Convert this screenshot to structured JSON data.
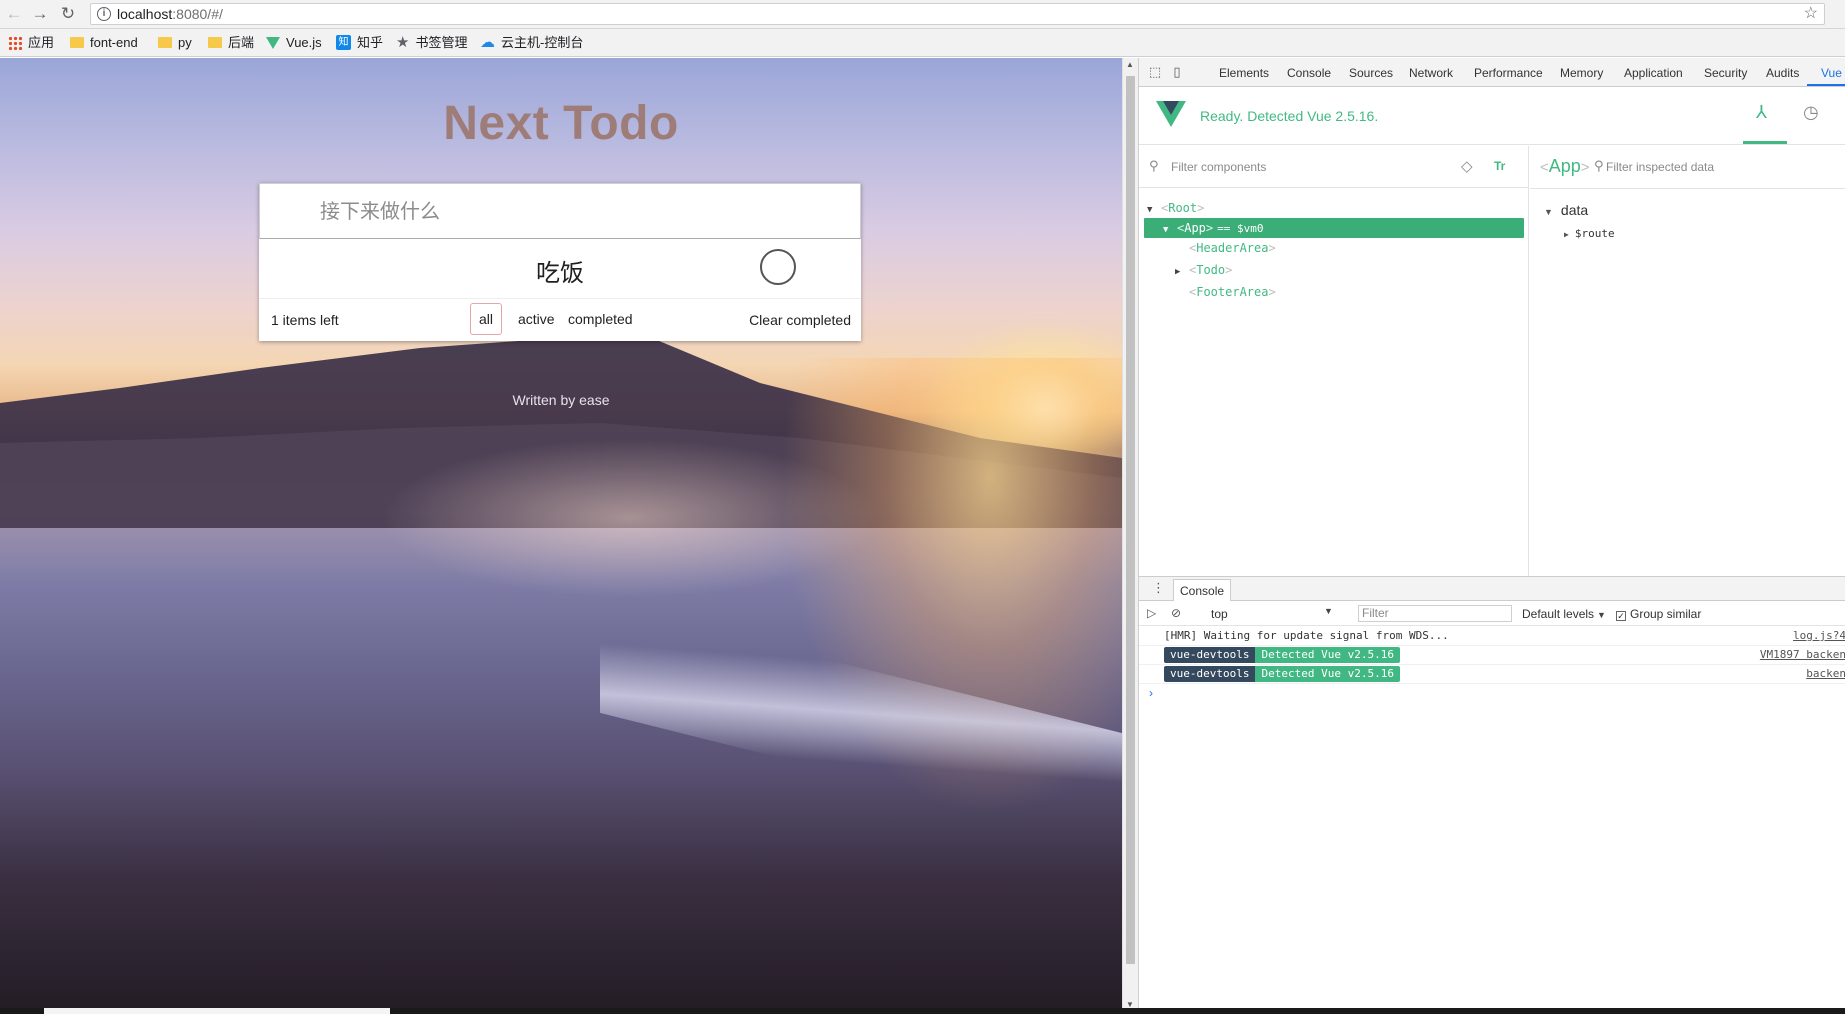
{
  "browser": {
    "url_host": "localhost",
    "url_rest": ":8080/#/",
    "bookmarks": [
      {
        "label": "应用",
        "icon": "apps-grid-icon"
      },
      {
        "label": "font-end",
        "icon": "folder-icon"
      },
      {
        "label": "py",
        "icon": "folder-icon"
      },
      {
        "label": "后端",
        "icon": "folder-icon"
      },
      {
        "label": "Vue.js",
        "icon": "vue-logo-icon"
      },
      {
        "label": "知乎",
        "icon": "zhihu-icon"
      },
      {
        "label": "书签管理",
        "icon": "star-icon"
      },
      {
        "label": "云主机-控制台",
        "icon": "cloud-icon"
      }
    ]
  },
  "app": {
    "title": "Next Todo",
    "input_placeholder": "接下来做什么",
    "todos": [
      {
        "text": "吃饭",
        "completed": false
      }
    ],
    "footer": {
      "items_left": "1 items left",
      "filters": [
        "all",
        "active",
        "completed"
      ],
      "selected_filter": "all",
      "clear_label": "Clear completed"
    },
    "credit": "Written by ease"
  },
  "devtools": {
    "tabs": [
      "Elements",
      "Console",
      "Sources",
      "Network",
      "Performance",
      "Memory",
      "Application",
      "Security",
      "Audits",
      "Vue"
    ],
    "active_tab": "Vue",
    "vue": {
      "status": "Ready. Detected Vue 2.5.16.",
      "filter_components_placeholder": "Filter components",
      "tt_label": "Tr",
      "tree": [
        {
          "name": "Root",
          "expanded": true,
          "selected": false
        },
        {
          "name": "App",
          "expanded": true,
          "selected": true,
          "ref": "== $vm0"
        },
        {
          "name": "HeaderArea",
          "expanded": null,
          "selected": false
        },
        {
          "name": "Todo",
          "expanded": false,
          "selected": false
        },
        {
          "name": "FooterArea",
          "expanded": null,
          "selected": false
        }
      ],
      "inspected": {
        "component": "App",
        "filter_placeholder": "Filter inspected data",
        "section": "data",
        "fields": [
          "$route"
        ]
      }
    },
    "console": {
      "tab_label": "Console",
      "context": "top",
      "filter_placeholder": "Filter",
      "levels": "Default levels",
      "group_similar": "Group similar",
      "logs": [
        {
          "text": "[HMR] Waiting for update signal from WDS...",
          "source": "log.js?4"
        },
        {
          "badge": "vue-devtools",
          "text": "Detected Vue v2.5.16",
          "source": "VM1897 backen"
        },
        {
          "badge": "vue-devtools",
          "text": "Detected Vue v2.5.16",
          "source": "backen"
        }
      ],
      "prompt": "›"
    },
    "accent_color": "#42b983"
  }
}
